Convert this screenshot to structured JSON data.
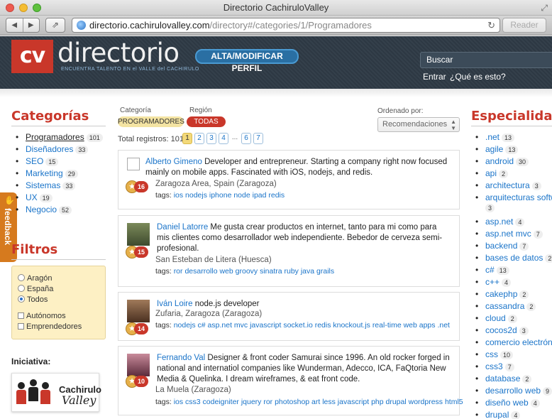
{
  "window": {
    "title": "Directorio CachiruloValley"
  },
  "browser": {
    "url_host": "directorio.cachirulovalley.com",
    "url_path": "/directory#/categories/1/Programadores",
    "reader_label": "Reader"
  },
  "header": {
    "logo_box": "cv",
    "logo_text": "directorio",
    "tagline": "ENCUENTRA TALENTO EN el VALLE del CACHIRULO",
    "alta_button": "ALTA/MODIFICAR PERFIL",
    "search_placeholder": "Buscar",
    "link_entrar": "Entrar",
    "link_que": "¿Qué es esto?"
  },
  "feedback_label": "feedback",
  "categorias": {
    "title": "Categorías",
    "items": [
      {
        "label": "Programadores",
        "count": "101"
      },
      {
        "label": "Diseñadores",
        "count": "33"
      },
      {
        "label": "SEO",
        "count": "15"
      },
      {
        "label": "Marketing",
        "count": "29"
      },
      {
        "label": "Sistemas",
        "count": "33"
      },
      {
        "label": "UX",
        "count": "19"
      },
      {
        "label": "Negocio",
        "count": "52"
      }
    ]
  },
  "filtros": {
    "title": "Filtros",
    "radios": [
      "Aragón",
      "España",
      "Todos"
    ],
    "checks": [
      "Autónomos",
      "Emprendedores"
    ]
  },
  "iniciativa": {
    "title": "Iniciativa:",
    "sponsor_line1": "Cachirulo",
    "sponsor_line2": "Valley"
  },
  "filters_bar": {
    "cat_label": "Categoría",
    "reg_label": "Región",
    "cat_value": "PROGRAMADORES",
    "reg_value": "TODAS",
    "order_label": "Ordenado por:",
    "order_value": "Recomendaciones",
    "total": "Total registros: 101",
    "pages": [
      "1",
      "2",
      "3",
      "4",
      "...",
      "6",
      "7"
    ]
  },
  "profiles": [
    {
      "name": "Alberto Gimeno",
      "bio": " Developer and entrepreneur. Starting a company right now focused mainly on mobile apps. Fascinated with iOS, nodejs, and redis.",
      "location": "Zaragoza Area, Spain (Zaragoza)",
      "tags_label": "tags:",
      "tags": "ios nodejs iphone node ipad redis",
      "score": "16"
    },
    {
      "name": "Daniel Latorre",
      "bio": " Me gusta crear productos en internet, tanto para mi como para mis clientes como desarrollador web independiente. Bebedor de cerveza semi-profesional.",
      "location": "San Esteban de Litera (Huesca)",
      "tags_label": "tags:",
      "tags": "ror desarrollo web groovy sinatra ruby java grails",
      "score": "15"
    },
    {
      "name": "Iván Loire",
      "bio": " node.js developer",
      "location": "Zufaria, Zaragoza (Zaragoza)",
      "tags_label": "tags:",
      "tags": "nodejs c# asp.net mvc javascript socket.io redis knockout.js real-time web apps .net",
      "score": "14"
    },
    {
      "name": "Fernando Val",
      "bio": " Designer & front coder Samurai since 1996. An old rocker forged in national and internatiol companies like Wunderman, Adecco, ICA, FaQtoria New Media & Quelinka. I dream wireframes, & eat front code.",
      "location": "La Muela (Zaragoza)",
      "tags_label": "tags:",
      "tags": "ios css3 codeigniter jquery ror photoshop art less javascript php drupal wordpress html5",
      "score": "10"
    }
  ],
  "especialidades": {
    "title": "Especialidades",
    "items": [
      {
        "label": ".net",
        "count": "13"
      },
      {
        "label": "agile",
        "count": "13"
      },
      {
        "label": "android",
        "count": "30"
      },
      {
        "label": "api",
        "count": "2"
      },
      {
        "label": "architectura",
        "count": "3"
      },
      {
        "label": "arquitecturas software",
        "count": "3"
      },
      {
        "label": "asp.net",
        "count": "4"
      },
      {
        "label": "asp.net mvc",
        "count": "7"
      },
      {
        "label": "backend",
        "count": "7"
      },
      {
        "label": "bases de datos",
        "count": "2"
      },
      {
        "label": "c#",
        "count": "13"
      },
      {
        "label": "c++",
        "count": "4"
      },
      {
        "label": "cakephp",
        "count": "2"
      },
      {
        "label": "cassandra",
        "count": "2"
      },
      {
        "label": "cloud",
        "count": "2"
      },
      {
        "label": "cocos2d",
        "count": "3"
      },
      {
        "label": "comercio electrónico",
        "count": ""
      },
      {
        "label": "css",
        "count": "10"
      },
      {
        "label": "css3",
        "count": "7"
      },
      {
        "label": "database",
        "count": "2"
      },
      {
        "label": "desarrollo web",
        "count": "9"
      },
      {
        "label": "diseño web",
        "count": "4"
      },
      {
        "label": "drupal",
        "count": "4"
      }
    ]
  },
  "colors": {
    "brand_red": "#c9372a",
    "link_blue": "#1a74c9",
    "header_bg": "#2e3a45"
  }
}
